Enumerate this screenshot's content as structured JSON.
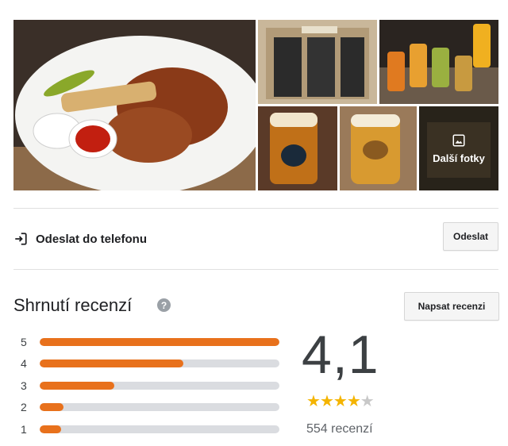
{
  "photos": {
    "more_label": "Další fotky"
  },
  "send": {
    "label": "Odeslat do telefonu",
    "button": "Odeslat"
  },
  "reviews": {
    "title": "Shrnutí recenzí",
    "write_button": "Napsat recenzi",
    "score": "4,1",
    "rating": 4.1,
    "count_text": "554 recenzí",
    "accent_color": "#e8711c",
    "star_color": "#f4b400",
    "distribution": [
      {
        "stars": "5",
        "fraction": 1.0
      },
      {
        "stars": "4",
        "fraction": 0.6
      },
      {
        "stars": "3",
        "fraction": 0.31
      },
      {
        "stars": "2",
        "fraction": 0.1
      },
      {
        "stars": "1",
        "fraction": 0.09
      }
    ]
  }
}
